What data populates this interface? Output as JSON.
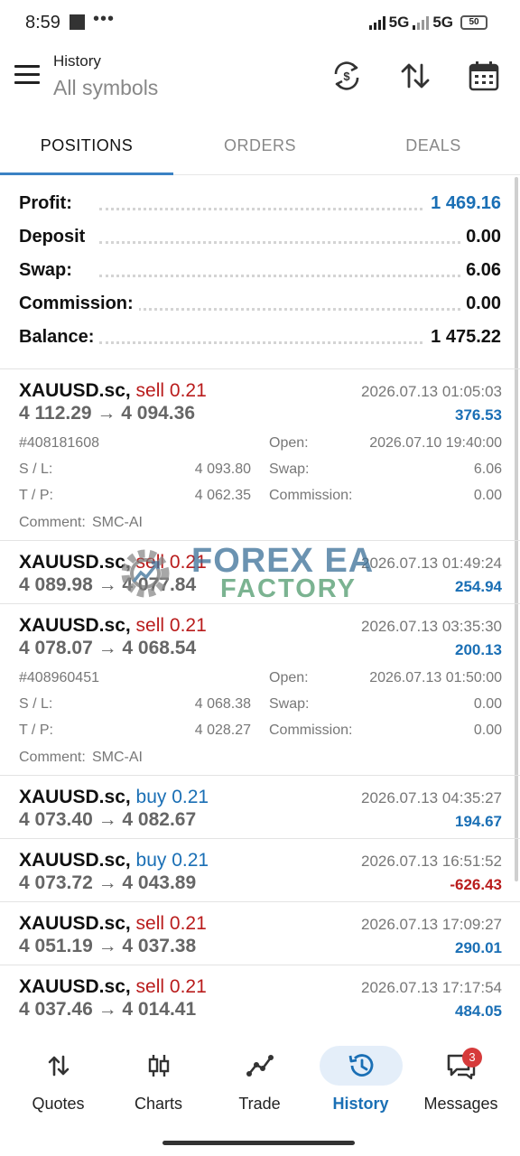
{
  "status_bar": {
    "time": "8:59",
    "dots": "•••",
    "net1": "5G",
    "net2": "5G",
    "battery": "50"
  },
  "app_bar": {
    "title": "History",
    "subtitle": "All symbols"
  },
  "tabs": [
    {
      "label": "POSITIONS"
    },
    {
      "label": "ORDERS"
    },
    {
      "label": "DEALS"
    }
  ],
  "summary": [
    {
      "label": "Profit:",
      "value": "1 469.16"
    },
    {
      "label": "Deposit",
      "value": "0.00"
    },
    {
      "label": "Swap:",
      "value": "6.06"
    },
    {
      "label": "Commission:",
      "value": "0.00"
    },
    {
      "label": "Balance:",
      "value": "1 475.22"
    }
  ],
  "deals": [
    {
      "symbol": "XAUUSD.sc,",
      "side": "sell 0.21",
      "prices": "4 112.29 → 4 094.36",
      "time": "2026.07.13 01:05:03",
      "profit": "376.53",
      "ticket": "#408181608",
      "open_label": "Open:",
      "open": "2026.07.10 19:40:00",
      "sl_label": "S / L:",
      "sl": "4 093.80",
      "swap_label": "Swap:",
      "swap": "6.06",
      "tp_label": "T / P:",
      "tp": "4 062.35",
      "commission_label": "Commission:",
      "commission": "0.00",
      "comment_label": "Comment:",
      "comment": "SMC-AI"
    },
    {
      "symbol": "XAUUSD.sc,",
      "side": "sell 0.21",
      "prices": "4 089.98 → 4 077.84",
      "time": "2026.07.13 01:49:24",
      "profit": "254.94"
    },
    {
      "symbol": "XAUUSD.sc,",
      "side": "sell 0.21",
      "prices": "4 078.07 → 4 068.54",
      "time": "2026.07.13 03:35:30",
      "profit": "200.13",
      "ticket": "#408960451",
      "open_label": "Open:",
      "open": "2026.07.13 01:50:00",
      "sl_label": "S / L:",
      "sl": "4 068.38",
      "swap_label": "Swap:",
      "swap": "0.00",
      "tp_label": "T / P:",
      "tp": "4 028.27",
      "commission_label": "Commission:",
      "commission": "0.00",
      "comment_label": "Comment:",
      "comment": "SMC-AI"
    },
    {
      "symbol": "XAUUSD.sc,",
      "side": "buy 0.21",
      "prices": "4 073.40 → 4 082.67",
      "time": "2026.07.13 04:35:27",
      "profit": "194.67"
    },
    {
      "symbol": "XAUUSD.sc,",
      "side": "buy 0.21",
      "prices": "4 073.72 → 4 043.89",
      "time": "2026.07.13 16:51:52",
      "profit": "-626.43"
    },
    {
      "symbol": "XAUUSD.sc,",
      "side": "sell 0.21",
      "prices": "4 051.19 → 4 037.38",
      "time": "2026.07.13 17:09:27",
      "profit": "290.01"
    },
    {
      "symbol": "XAUUSD.sc,",
      "side": "sell 0.21",
      "prices": "4 037.46 → 4 014.41",
      "time": "2026.07.13 17:17:54",
      "profit": "484.05"
    }
  ],
  "watermark": {
    "line1": "FOREX EA",
    "line2": "FACTORY"
  },
  "bottom_nav": [
    {
      "label": "Quotes"
    },
    {
      "label": "Charts"
    },
    {
      "label": "Trade"
    },
    {
      "label": "History"
    },
    {
      "label": "Messages"
    }
  ],
  "messages_badge": "3",
  "colors": {
    "accent": "#1a6fb5",
    "loss": "#b91c1c",
    "tab_underline": "#3b82c4"
  }
}
